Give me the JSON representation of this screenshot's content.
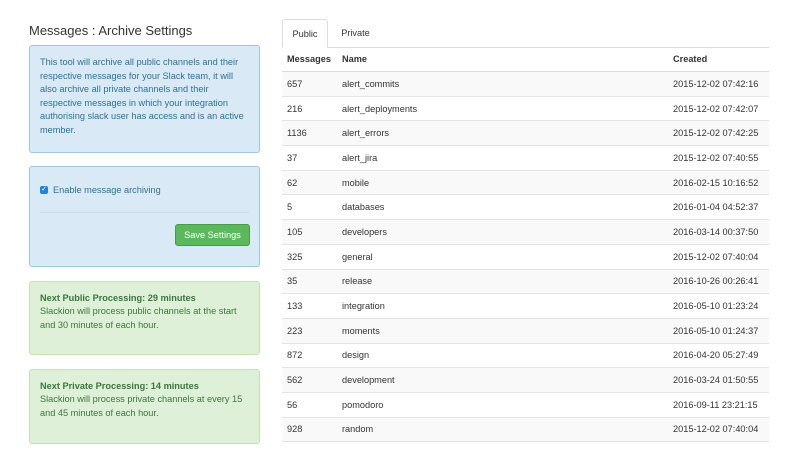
{
  "page": {
    "title": "Messages : Archive Settings"
  },
  "info_panel": {
    "text": "This tool will archive all public channels and their respective messages for your Slack team, it will also archive all private channels and their respective messages in which your integration authorising slack user has access and is an active member."
  },
  "settings_panel": {
    "checkbox_label": "Enable message archiving",
    "checkbox_checked": true,
    "save_label": "Save Settings"
  },
  "public_processing": {
    "heading": "Next Public Processing: 29 minutes",
    "text": "Slackion will process public channels at the start and 30 minutes of each hour."
  },
  "private_processing": {
    "heading": "Next Private Processing: 14 minutes",
    "text": "Slackion will process private channels at every 15 and 45 minutes of each hour."
  },
  "tabs": [
    {
      "label": "Public",
      "active": true
    },
    {
      "label": "Private",
      "active": false
    }
  ],
  "table": {
    "headers": [
      "Messages",
      "Name",
      "Created"
    ],
    "rows": [
      [
        "657",
        "alert_commits",
        "2015-12-02 07:42:16"
      ],
      [
        "216",
        "alert_deployments",
        "2015-12-02 07:42:07"
      ],
      [
        "1136",
        "alert_errors",
        "2015-12-02 07:42:25"
      ],
      [
        "37",
        "alert_jira",
        "2015-12-02 07:40:55"
      ],
      [
        "62",
        "mobile",
        "2016-02-15 10:16:52"
      ],
      [
        "5",
        "databases",
        "2016-01-04 04:52:37"
      ],
      [
        "105",
        "developers",
        "2016-03-14 00:37:50"
      ],
      [
        "325",
        "general",
        "2015-12-02 07:40:04"
      ],
      [
        "35",
        "release",
        "2016-10-26 00:26:41"
      ],
      [
        "133",
        "integration",
        "2016-05-10 01:23:24"
      ],
      [
        "223",
        "moments",
        "2016-05-10 01:24:37"
      ],
      [
        "872",
        "design",
        "2016-04-20 05:27:49"
      ],
      [
        "562",
        "development",
        "2016-03-24 01:50:55"
      ],
      [
        "56",
        "pomodoro",
        "2016-09-11 23:21:15"
      ],
      [
        "928",
        "random",
        "2015-12-02 07:40:04"
      ]
    ]
  },
  "colors": {
    "info_bg": "#d9eaf6",
    "success_bg": "#dff0d8",
    "save_button": "#5cb85c",
    "checkbox": "#2b7fd8"
  }
}
